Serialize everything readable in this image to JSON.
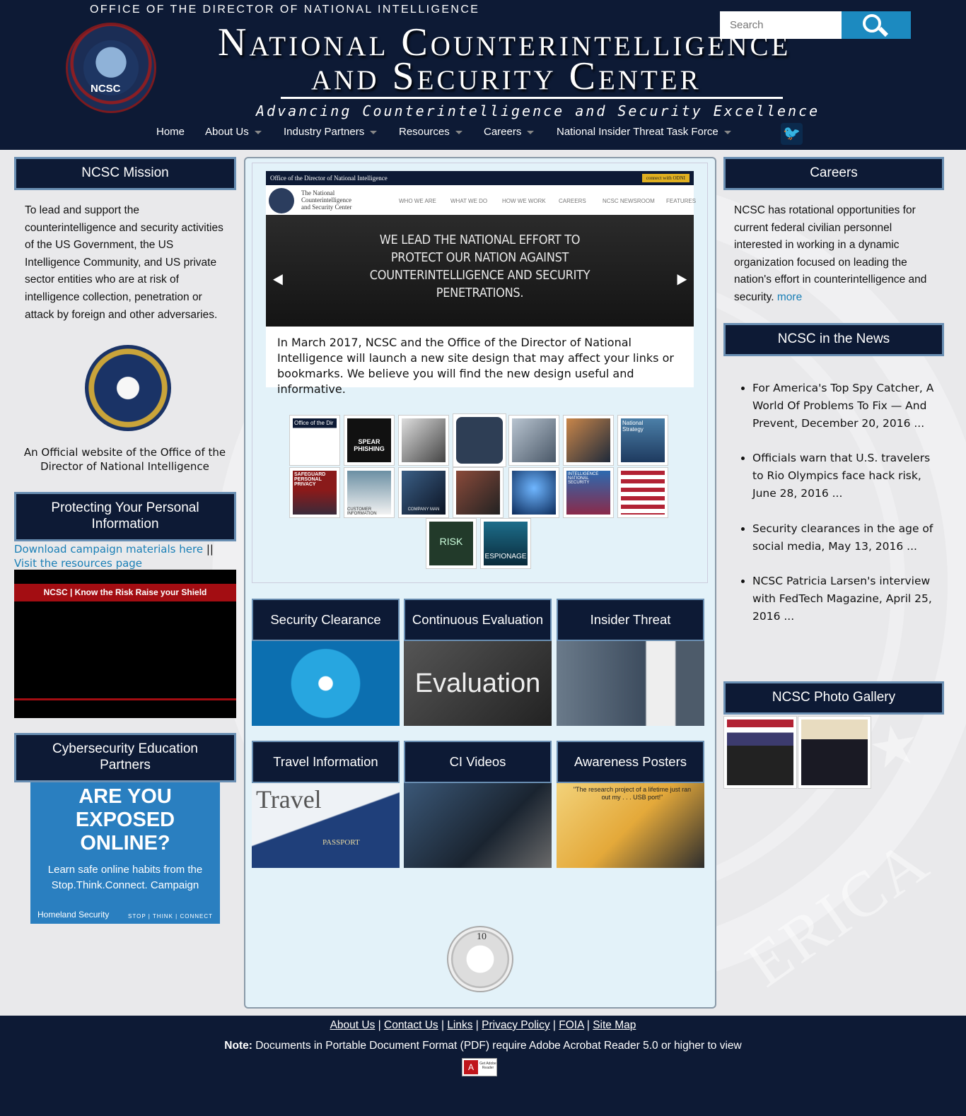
{
  "header": {
    "odni": "OFFICE OF THE DIRECTOR OF NATIONAL INTELLIGENCE",
    "logo_text": "NCSC",
    "title_line1": "National Counterintelligence",
    "title_line2": "and Security Center",
    "tagline": "Advancing Counterintelligence and Security Excellence",
    "search_placeholder": "Search"
  },
  "nav": {
    "items": [
      "Home",
      "About Us",
      "Industry Partners",
      "Resources",
      "Careers",
      "National Insider Threat Task Force"
    ]
  },
  "left": {
    "mission_title": "NCSC Mission",
    "mission_text": "To lead and support the counterintelligence and security activities of the US Government, the US Intelligence Community, and US private sector entities who are at risk of intelligence collection, penetration or attack by foreign and other adversaries.",
    "official_text": "An Official website of the Office of the Director of National Intelligence",
    "personal_title": "Protecting Your Personal Information",
    "download_link": "Download campaign materials here",
    "separator": "||",
    "resources_link": "Visit the resources page",
    "video_banner": "NCSC | Know the Risk Raise your Shield",
    "cyber_title": "Cybersecurity Education Partners",
    "ad_line1": "ARE YOU",
    "ad_line2": "EXPOSED",
    "ad_line3": "ONLINE?",
    "ad_sub1": "Learn safe online habits from the",
    "ad_sub2": "Stop.Think.Connect. Campaign",
    "ad_foot_left": "Homeland Security",
    "ad_foot_right": "STOP | THINK | CONNECT"
  },
  "slider": {
    "top_bar": "Office of the Director of National Intelligence",
    "top_button": "connect with ODNI",
    "mini_name": "The National Counterintelligence and Security Center",
    "mini_nav": [
      "WHO WE ARE",
      "WHAT WE DO",
      "HOW WE WORK",
      "CAREERS",
      "NCSC NEWSROOM",
      "FEATURES"
    ],
    "hero": "WE LEAD THE NATIONAL EFFORT TO PROTECT OUR NATION AGAINST COUNTERINTELLIGENCE AND SECURITY PENETRATIONS.",
    "caption": "In March 2017, NCSC and the Office of the Director of National Intelligence will launch a new site design that may affect your links or bookmarks. We believe you will find the new design useful and informative."
  },
  "thumbs": {
    "t1": "Office of the Dir",
    "t2": "SPEAR PHISHING",
    "t7": "National Strategy",
    "t8": "SAFEGUARD PERSONAL PRIVACY",
    "t9": "CUSTOMER INFORMATION",
    "t10": "COMPANY MAN",
    "t13": "INTELLIGENCE NATIONAL SECURITY",
    "t15": "RISK",
    "t16": "ESPIONAGE"
  },
  "tiles": {
    "security_clearance": "Security Clearance",
    "continuous_evaluation": "Continuous Evaluation",
    "evaluation_img": "Evaluation",
    "insider_threat": "Insider Threat",
    "travel_information": "Travel Information",
    "travel_img": "Travel",
    "passport_img": "PASSPORT",
    "ci_videos": "CI Videos",
    "awareness_posters": "Awareness Posters",
    "poster_quote": "\"The research project of a lifetime just ran out my . . . USB port!\""
  },
  "right": {
    "careers_title": "Careers",
    "careers_text": "NCSC has rotational opportunities for current federal civilian personnel interested in working in a dynamic organization focused on leading the nation's effort in counterintelligence and security.",
    "more": "more",
    "news_title": "NCSC in the News",
    "news": [
      "For America's Top Spy Catcher, A World Of Problems To Fix — And Prevent, December 20, 2016 ...",
      "Officials warn that U.S. travelers to Rio Olympics face hack risk, June 28, 2016 ...",
      "Security clearances in the age of social media, May 13, 2016 ...",
      "NCSC Patricia Larsen's interview with FedTech Magazine, April 25, 2016 ..."
    ],
    "gallery_title": "NCSC Photo Gallery"
  },
  "footer": {
    "links": [
      "About Us",
      "Contact Us",
      "Links",
      "Privacy Policy",
      "FOIA",
      "Site Map"
    ],
    "note_label": "Note:",
    "note_text": "Documents in Portable Document Format (PDF) require Adobe Acrobat Reader 5.0 or higher to view",
    "pdf_label": "Get Adobe Reader"
  },
  "seal_text": "10",
  "colors": {
    "navy": "#0d1a35",
    "accent": "#1c8ac0",
    "panel_border": "#6a8fb3"
  }
}
